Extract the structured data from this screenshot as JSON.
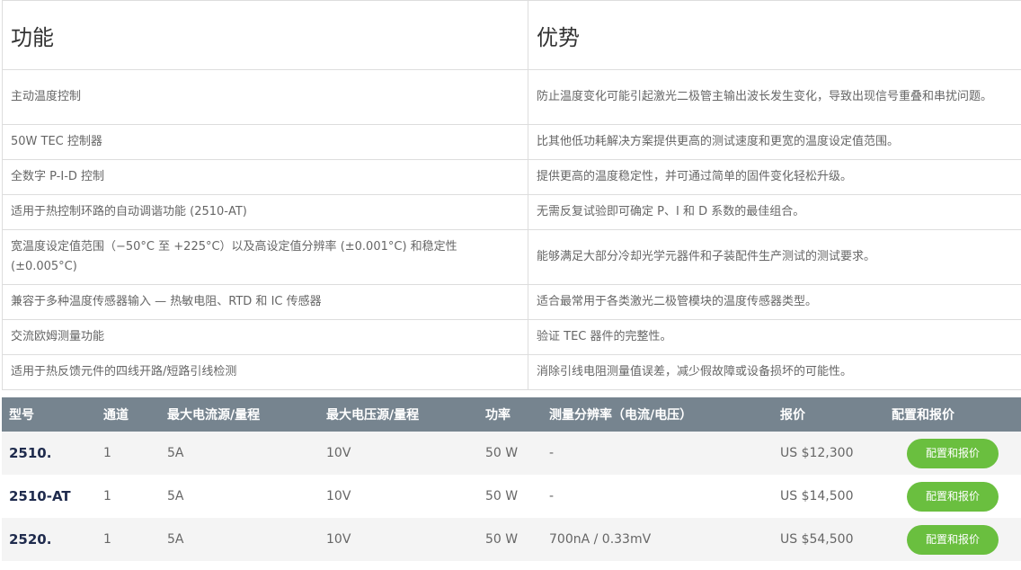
{
  "features": {
    "headers": [
      "功能",
      "优势"
    ],
    "rows": [
      {
        "feature": "主动温度控制",
        "benefit": "防止温度变化可能引起激光二极管主输出波长发生变化，导致出现信号重叠和串扰问题。"
      },
      {
        "feature": "50W TEC 控制器",
        "benefit": "比其他低功耗解决方案提供更高的测试速度和更宽的温度设定值范围。"
      },
      {
        "feature": "全数字 P-I-D 控制",
        "benefit": "提供更高的温度稳定性，并可通过简单的固件变化轻松升级。"
      },
      {
        "feature": "适用于热控制环路的自动调谐功能 (2510-AT)",
        "benefit": "无需反复试验即可确定 P、I 和 D 系数的最佳组合。"
      },
      {
        "feature": "宽温度设定值范围（−50°C 至 +225°C）以及高设定值分辨率 (±0.001°C) 和稳定性 (±0.005°C)",
        "benefit": "能够满足大部分冷却光学元器件和子装配件生产测试的测试要求。"
      },
      {
        "feature": "兼容于多种温度传感器输入 — 热敏电阻、RTD 和 IC 传感器",
        "benefit": "适合最常用于各类激光二极管模块的温度传感器类型。"
      },
      {
        "feature": "交流欧姆测量功能",
        "benefit": "验证 TEC 器件的完整性。"
      },
      {
        "feature": "适用于热反馈元件的四线开路/短路引线检测",
        "benefit": "消除引线电阻测量值误差，减少假故障或设备损坏的可能性。"
      }
    ]
  },
  "models": {
    "headers": [
      "型号",
      "通道",
      "最大电流源/量程",
      "最大电压源/量程",
      "功率",
      "测量分辨率（电流/电压）",
      "报价",
      "配置和报价"
    ],
    "rows": [
      {
        "model": "2510.",
        "channels": "1",
        "current": "5A",
        "voltage": "10V",
        "power": "50 W",
        "resolution": "-",
        "price": "US $12,300",
        "button": "配置和报价"
      },
      {
        "model": "2510-AT",
        "channels": "1",
        "current": "5A",
        "voltage": "10V",
        "power": "50 W",
        "resolution": "-",
        "price": "US $14,500",
        "button": "配置和报价"
      },
      {
        "model": "2520.",
        "channels": "1",
        "current": "5A",
        "voltage": "10V",
        "power": "50 W",
        "resolution": "700nA / 0.33mV",
        "price": "US $54,500",
        "button": "配置和报价"
      }
    ]
  },
  "colors": {
    "header_bg": "#76848f",
    "button_bg": "#6abf3f",
    "model_text": "#1f2b4d"
  }
}
